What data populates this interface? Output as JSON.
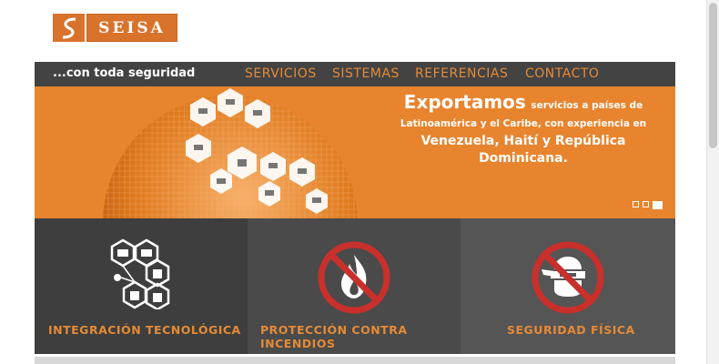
{
  "logo": {
    "text": "SEISA"
  },
  "nav": {
    "tagline": "...con toda seguridad",
    "items": [
      "SERVICIOS",
      "SISTEMAS",
      "REFERENCIAS",
      "CONTACTO"
    ]
  },
  "banner": {
    "headline": "Exportamos",
    "line1": "servicios a países de",
    "line2": "Latinoamérica y el Caribe, con experiencia en",
    "line3": "Venezuela, Haití y República",
    "line4": "Dominicana.",
    "slides_total": 3,
    "slide_active": 3
  },
  "cards": [
    {
      "title": "INTEGRACIÓN TECNOLÓGICA",
      "icon": "network-hexagon-icon"
    },
    {
      "title": "PROTECCIÓN CONTRA INCENDIOS",
      "icon": "no-fire-icon"
    },
    {
      "title": "SEGURIDAD FÍSICA",
      "icon": "no-thief-icon"
    }
  ],
  "colors": {
    "accent": "#e58a36",
    "dark": "#434343",
    "banner": "#e8842d"
  }
}
